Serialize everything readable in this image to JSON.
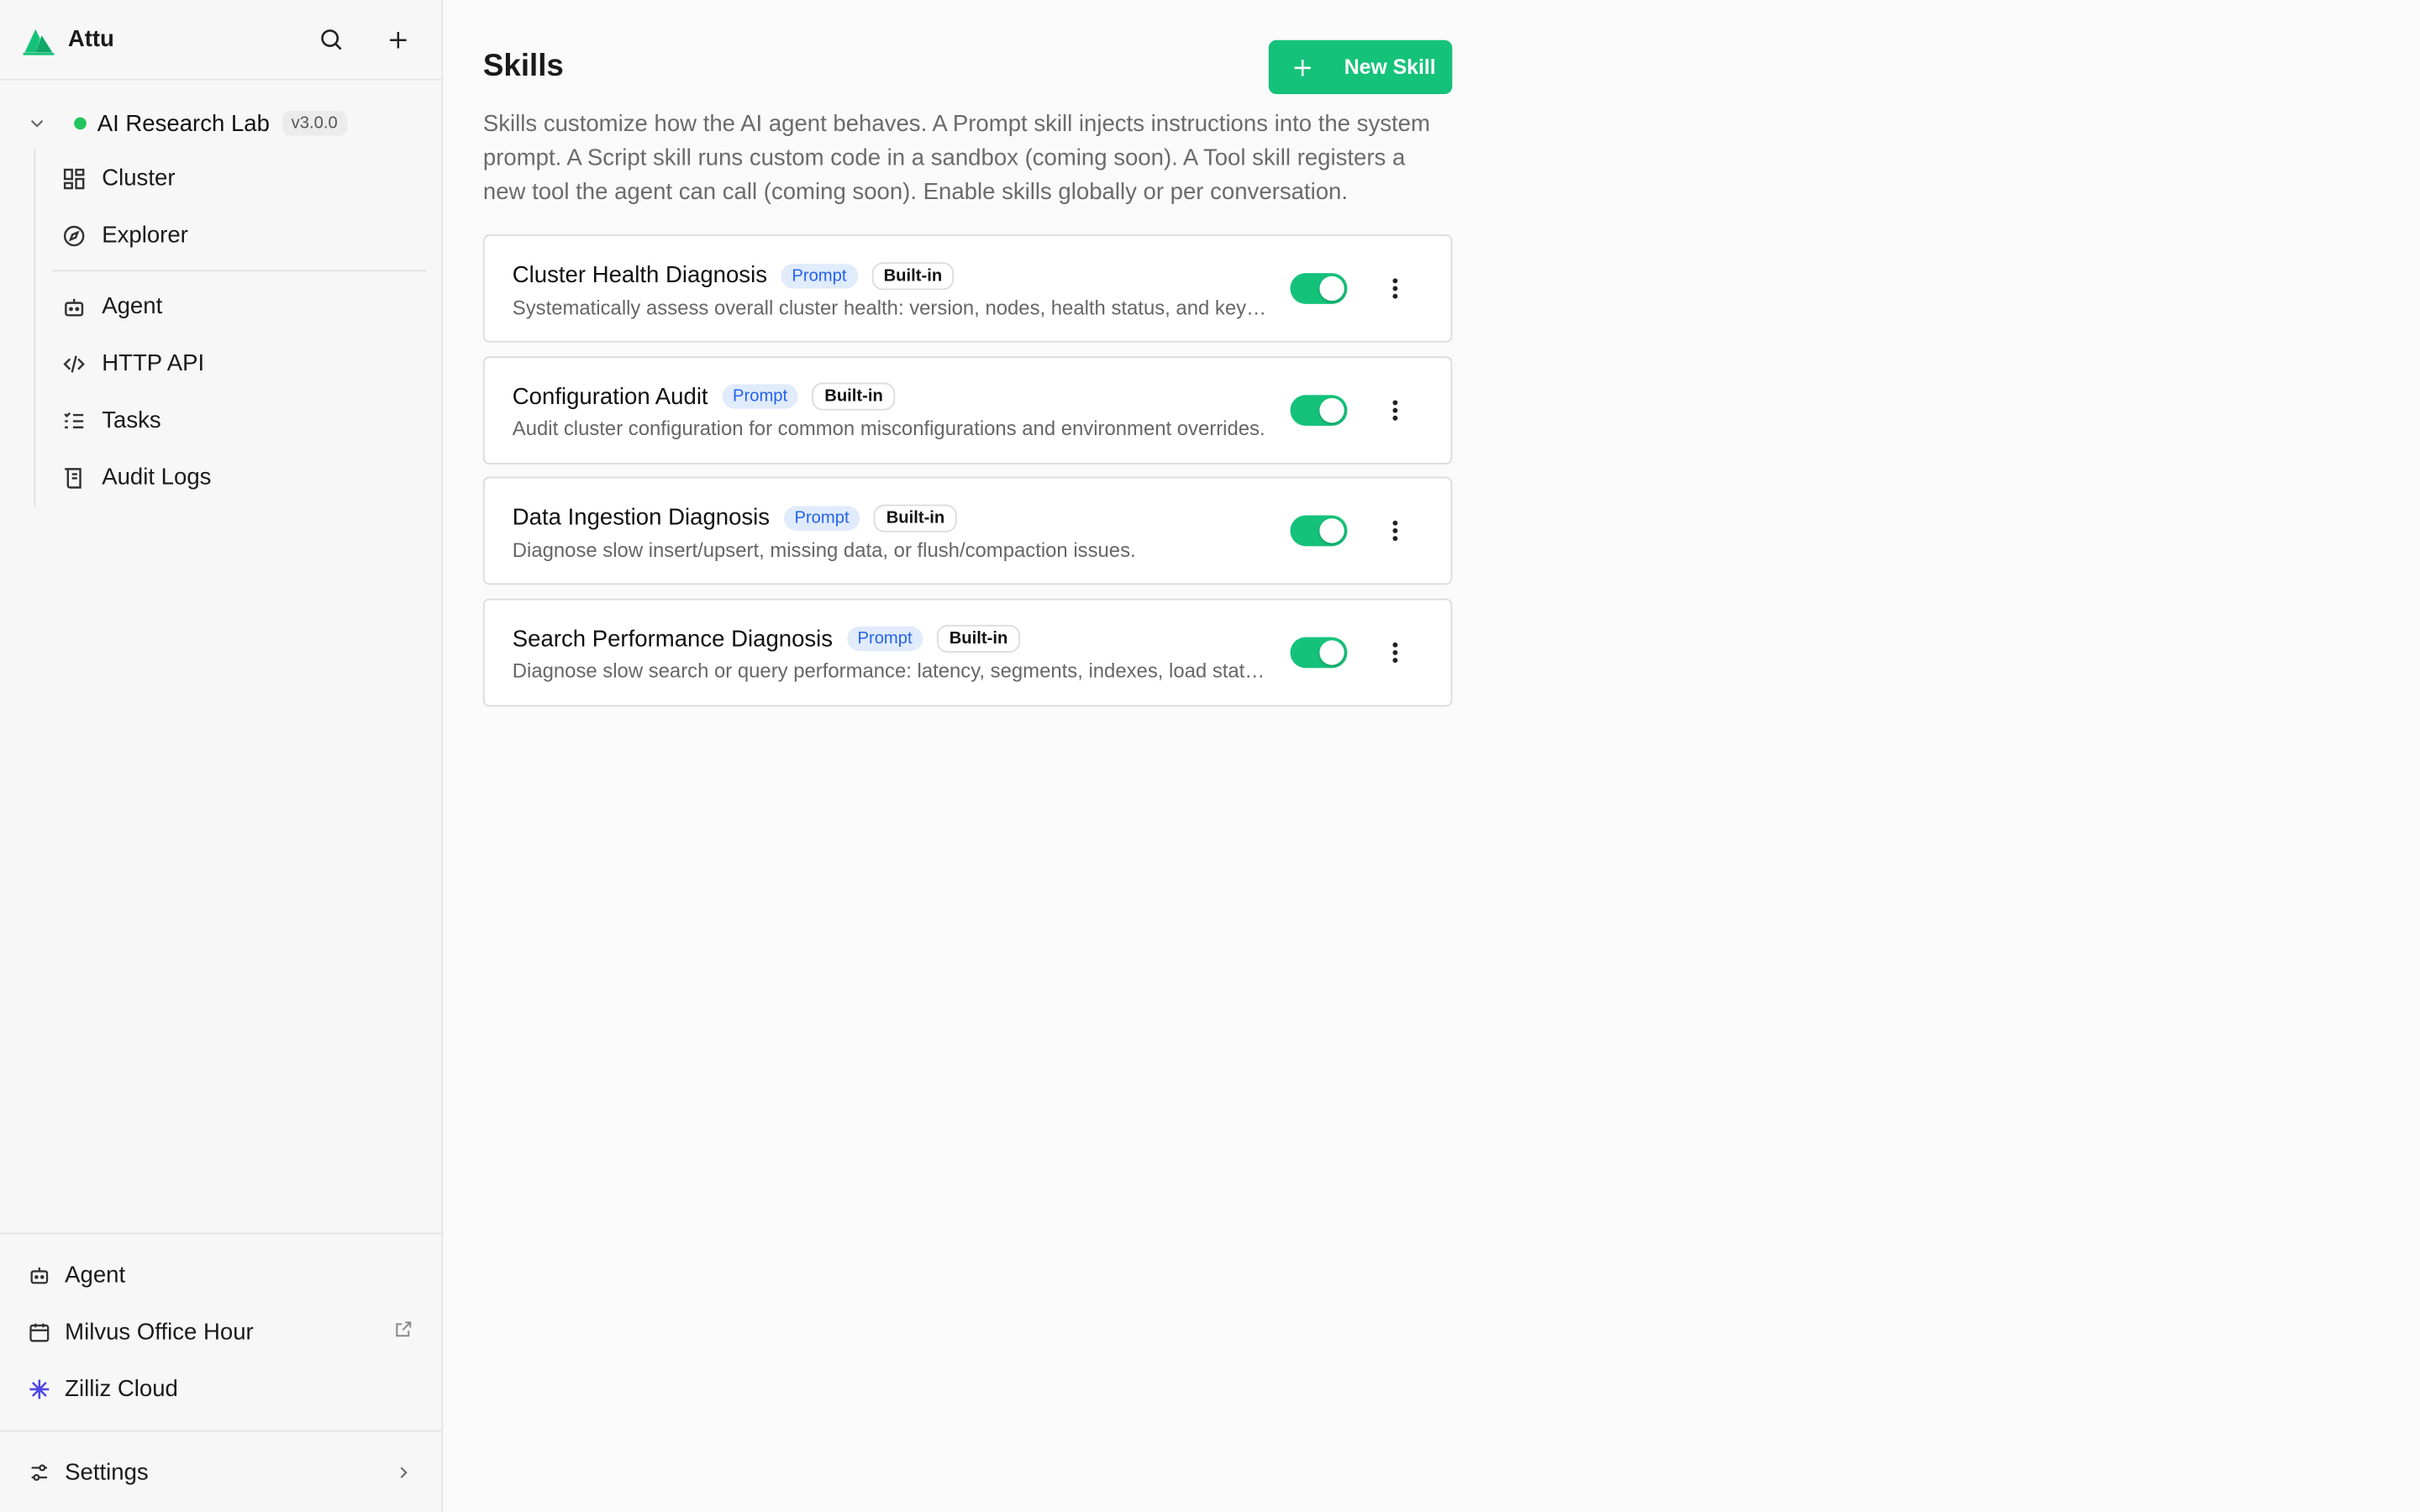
{
  "app": {
    "name": "Attu"
  },
  "sidebar": {
    "cluster": {
      "name": "AI Research Lab",
      "version": "v3.0.0"
    },
    "items": [
      {
        "label": "Cluster",
        "icon": "dashboard-icon"
      },
      {
        "label": "Explorer",
        "icon": "compass-icon"
      }
    ],
    "items2": [
      {
        "label": "Agent",
        "icon": "robot-icon"
      },
      {
        "label": "HTTP API",
        "icon": "code-icon"
      },
      {
        "label": "Tasks",
        "icon": "tasks-icon"
      },
      {
        "label": "Audit Logs",
        "icon": "scroll-icon"
      }
    ],
    "bottom": [
      {
        "label": "Agent",
        "icon": "robot-icon"
      },
      {
        "label": "Milvus Office Hour",
        "icon": "calendar-icon"
      },
      {
        "label": "Zilliz Cloud",
        "icon": "zilliz-icon"
      }
    ],
    "settings_label": "Settings"
  },
  "main": {
    "title": "Skills",
    "new_button": "New Skill",
    "description": "Skills customize how the AI agent behaves. A Prompt skill injects instructions into the system prompt. A Script skill runs custom code in a sandbox (coming soon). A Tool skill registers a new tool the agent can call (coming soon). Enable skills globally or per conversation.",
    "skills": [
      {
        "name": "Cluster Health Diagnosis",
        "type": "Prompt",
        "source": "Built-in",
        "description": "Systematically assess overall cluster health: version, nodes, health status, and key metrics.",
        "enabled": true
      },
      {
        "name": "Configuration Audit",
        "type": "Prompt",
        "source": "Built-in",
        "description": "Audit cluster configuration for common misconfigurations and environment overrides.",
        "enabled": true
      },
      {
        "name": "Data Ingestion Diagnosis",
        "type": "Prompt",
        "source": "Built-in",
        "description": "Diagnose slow insert/upsert, missing data, or flush/compaction issues.",
        "enabled": true
      },
      {
        "name": "Search Performance Diagnosis",
        "type": "Prompt",
        "source": "Built-in",
        "description": "Diagnose slow search or query performance: latency, segments, indexes, load status.",
        "enabled": true
      }
    ]
  },
  "colors": {
    "accent": "#15c27a",
    "prompt_tag": "#2563eb",
    "status_online": "#22c55e"
  }
}
